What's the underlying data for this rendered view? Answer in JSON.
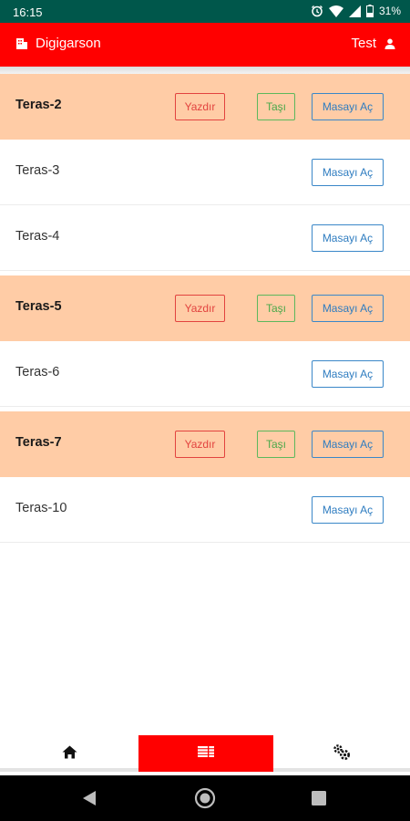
{
  "status_bar": {
    "time": "16:15",
    "battery": "31%"
  },
  "app_bar": {
    "title": "Digigarson",
    "user_name": "Test"
  },
  "tables": [
    {
      "name": "Teras-2",
      "occupied": true,
      "print_label": "Yazdır",
      "move_label": "Taşı",
      "open_label": "Masayı Aç"
    },
    {
      "name": "Teras-3",
      "occupied": false,
      "open_label": "Masayı Aç"
    },
    {
      "name": "Teras-4",
      "occupied": false,
      "open_label": "Masayı Aç"
    },
    {
      "name": "Teras-5",
      "occupied": true,
      "print_label": "Yazdır",
      "move_label": "Taşı",
      "open_label": "Masayı Aç"
    },
    {
      "name": "Teras-6",
      "occupied": false,
      "open_label": "Masayı Aç"
    },
    {
      "name": "Teras-7",
      "occupied": true,
      "print_label": "Yazdır",
      "move_label": "Taşı",
      "open_label": "Masayı Aç"
    },
    {
      "name": "Teras-10",
      "occupied": false,
      "open_label": "Masayı Aç"
    }
  ],
  "bottom_nav": {
    "items": [
      {
        "icon": "home-icon",
        "active": false
      },
      {
        "icon": "list-icon",
        "active": true
      },
      {
        "icon": "gears-icon",
        "active": false
      }
    ]
  },
  "colors": {
    "status_bar": "#00574b",
    "app_bar": "#ff0000",
    "occupied_row": "#ffcca6",
    "print": "#e2433f",
    "move": "#5cb85c",
    "open": "#3a87c8"
  }
}
